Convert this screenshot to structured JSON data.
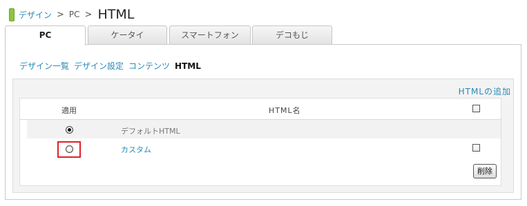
{
  "breadcrumb": {
    "design_link": "デザイン",
    "separator": ">",
    "pc": "PC",
    "current": "HTML"
  },
  "tabs": [
    {
      "label": "PC",
      "active": true
    },
    {
      "label": "ケータイ",
      "active": false
    },
    {
      "label": "スマートフォン",
      "active": false
    },
    {
      "label": "デコもじ",
      "active": false
    }
  ],
  "subnav": {
    "items": [
      "デザイン一覧",
      "デザイン設定",
      "コンテンツ"
    ],
    "current": "HTML"
  },
  "add_html_link": "HTMLの追加",
  "table": {
    "col_apply": "適用",
    "col_name": "HTML名",
    "rows": [
      {
        "name": "デフォルトHTML",
        "applied": true,
        "deletable": false
      },
      {
        "name": "カスタム",
        "applied": false,
        "deletable": true
      }
    ]
  },
  "delete_button": "削除",
  "colors": {
    "link": "#2a89b6",
    "highlight_border": "#e0202a",
    "breadcrumb_marker": "#8cc63f"
  }
}
